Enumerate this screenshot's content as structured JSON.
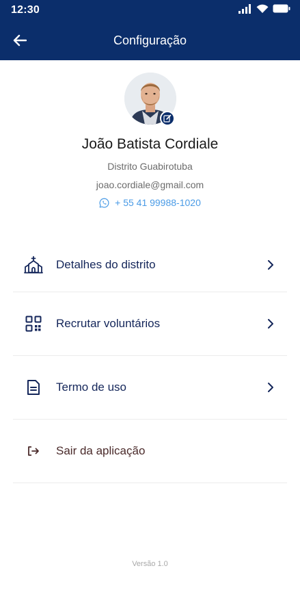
{
  "status_bar": {
    "time": "12:30"
  },
  "app_bar": {
    "title": "Configuração"
  },
  "profile": {
    "name": "João Batista Cordiale",
    "district": "Distrito Guabirotuba",
    "email": "joao.cordiale@gmail.com",
    "phone": "+ 55 41 99988-1020"
  },
  "menu": {
    "items": [
      {
        "label": "Detalhes do distrito",
        "icon": "church-icon"
      },
      {
        "label": "Recrutar voluntários",
        "icon": "qr-code-icon"
      },
      {
        "label": "Termo de uso",
        "icon": "document-icon"
      },
      {
        "label": "Sair da aplicação",
        "icon": "logout-icon"
      }
    ]
  },
  "footer": {
    "version": "Versão 1.0"
  },
  "colors": {
    "header": "#0b2e6b",
    "menu_text": "#14265a",
    "link": "#4a9be6",
    "muted": "#6b6b6b"
  }
}
